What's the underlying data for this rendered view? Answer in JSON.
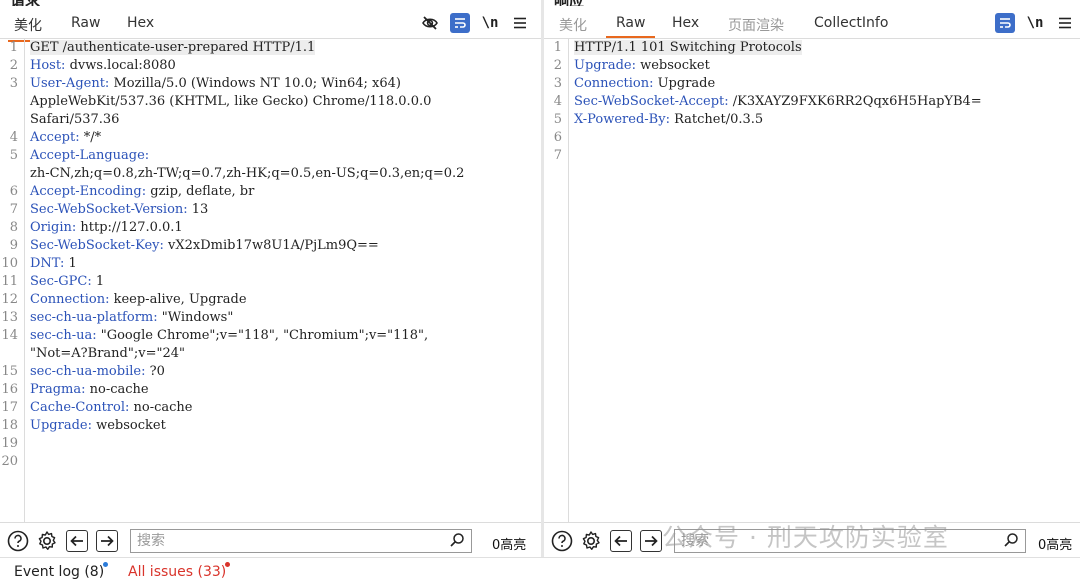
{
  "request": {
    "title": "请求",
    "tabs": [
      {
        "label": "美化"
      },
      {
        "label": "Raw"
      },
      {
        "label": "Hex"
      }
    ],
    "active_tab": "美化",
    "newline_label": "\\n",
    "lines": [
      {
        "n": "1",
        "key": "",
        "value": "GET /authenticate-user-prepared HTTP/1.1"
      },
      {
        "n": "2",
        "key": "Host:",
        "value": " dvws.local:8080"
      },
      {
        "n": "3",
        "key": "User-Agent:",
        "value": " Mozilla/5.0 (Windows NT 10.0; Win64; x64)"
      },
      {
        "n": "",
        "key": "",
        "value": "AppleWebKit/537.36 (KHTML, like Gecko) Chrome/118.0.0.0"
      },
      {
        "n": "",
        "key": "",
        "value": "Safari/537.36"
      },
      {
        "n": "4",
        "key": "Accept:",
        "value": " */*"
      },
      {
        "n": "5",
        "key": "Accept-Language:",
        "value": ""
      },
      {
        "n": "",
        "key": "",
        "value": "zh-CN,zh;q=0.8,zh-TW;q=0.7,zh-HK;q=0.5,en-US;q=0.3,en;q=0.2"
      },
      {
        "n": "6",
        "key": "Accept-Encoding:",
        "value": " gzip, deflate, br"
      },
      {
        "n": "7",
        "key": "Sec-WebSocket-Version:",
        "value": " 13"
      },
      {
        "n": "8",
        "key": "Origin:",
        "value": " http://127.0.0.1"
      },
      {
        "n": "9",
        "key": "Sec-WebSocket-Key:",
        "value": " vX2xDmib17w8U1A/PjLm9Q=="
      },
      {
        "n": "10",
        "key": "DNT:",
        "value": " 1"
      },
      {
        "n": "11",
        "key": "Sec-GPC:",
        "value": " 1"
      },
      {
        "n": "12",
        "key": "Connection:",
        "value": " keep-alive, Upgrade"
      },
      {
        "n": "13",
        "key": "sec-ch-ua-platform:",
        "value": " \"Windows\""
      },
      {
        "n": "14",
        "key": "sec-ch-ua:",
        "value": " \"Google Chrome\";v=\"118\", \"Chromium\";v=\"118\","
      },
      {
        "n": "",
        "key": "",
        "value": "\"Not=A?Brand\";v=\"24\""
      },
      {
        "n": "15",
        "key": "sec-ch-ua-mobile:",
        "value": " ?0"
      },
      {
        "n": "16",
        "key": "Pragma:",
        "value": " no-cache"
      },
      {
        "n": "17",
        "key": "Cache-Control:",
        "value": " no-cache"
      },
      {
        "n": "18",
        "key": "Upgrade:",
        "value": " websocket"
      },
      {
        "n": "19",
        "key": "",
        "value": ""
      },
      {
        "n": "20",
        "key": "",
        "value": ""
      }
    ],
    "search_placeholder": "搜索",
    "highlight_count": "0高亮"
  },
  "response": {
    "title": "响应",
    "tabs": [
      {
        "label": "美化"
      },
      {
        "label": "Raw"
      },
      {
        "label": "Hex"
      },
      {
        "label": "页面渲染"
      },
      {
        "label": "CollectInfo"
      }
    ],
    "active_tab": "Raw",
    "newline_label": "\\n",
    "lines": [
      {
        "n": "1",
        "key": "",
        "value": "HTTP/1.1 101 Switching Protocols"
      },
      {
        "n": "2",
        "key": "Upgrade:",
        "value": " websocket"
      },
      {
        "n": "3",
        "key": "Connection:",
        "value": " Upgrade"
      },
      {
        "n": "4",
        "key": "Sec-WebSocket-Accept:",
        "value": " /K3XAYZ9FXK6RR2Qqx6H5HapYB4="
      },
      {
        "n": "5",
        "key": "X-Powered-By:",
        "value": " Ratchet/0.3.5"
      },
      {
        "n": "6",
        "key": "",
        "value": ""
      },
      {
        "n": "7",
        "key": "",
        "value": ""
      }
    ],
    "search_placeholder": "搜索",
    "highlight_count": "0高亮"
  },
  "status": {
    "event_log": "Event log (8)",
    "all_issues": "All issues (33)"
  },
  "watermark": "公众号 · 刑天攻防实验室",
  "colors": {
    "accent_tab": "#e8681e",
    "header_key": "#2b52b8",
    "issues": "#d9342b",
    "event_dot": "#2b7bd9",
    "wrap_button": "#3d6ec9"
  }
}
